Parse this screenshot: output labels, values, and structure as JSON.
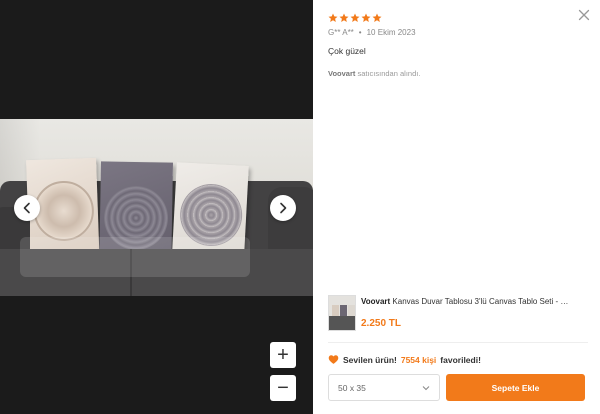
{
  "review": {
    "rating": 5,
    "reviewer": "G** A**",
    "separator": "•",
    "date": "10 Ekim 2023",
    "comment": "Çok güzel",
    "seller_name": "Voovart",
    "seller_suffix": " satıcısından alındı."
  },
  "product": {
    "brand": "Voovart",
    "title": " Kanvas Duvar Tablosu 3'lü Canvas Tablo Seti - …",
    "price": "2.250 TL"
  },
  "favorite": {
    "prefix": "Sevilen ürün! ",
    "count": "7554 kişi",
    "suffix": " favoriledi!"
  },
  "size_select": {
    "value": "50 x 35"
  },
  "add_to_cart_label": "Sepete Ekle",
  "zoom": {
    "in_label": "+",
    "out_label": "−"
  },
  "colors": {
    "accent": "#f27a1a",
    "star": "#f27a1a",
    "gallery_bg": "#1b1b1b"
  },
  "icons": [
    "chevron-left-icon",
    "chevron-right-icon",
    "close-icon",
    "star-icon",
    "heart-icon",
    "chevron-down-icon"
  ]
}
